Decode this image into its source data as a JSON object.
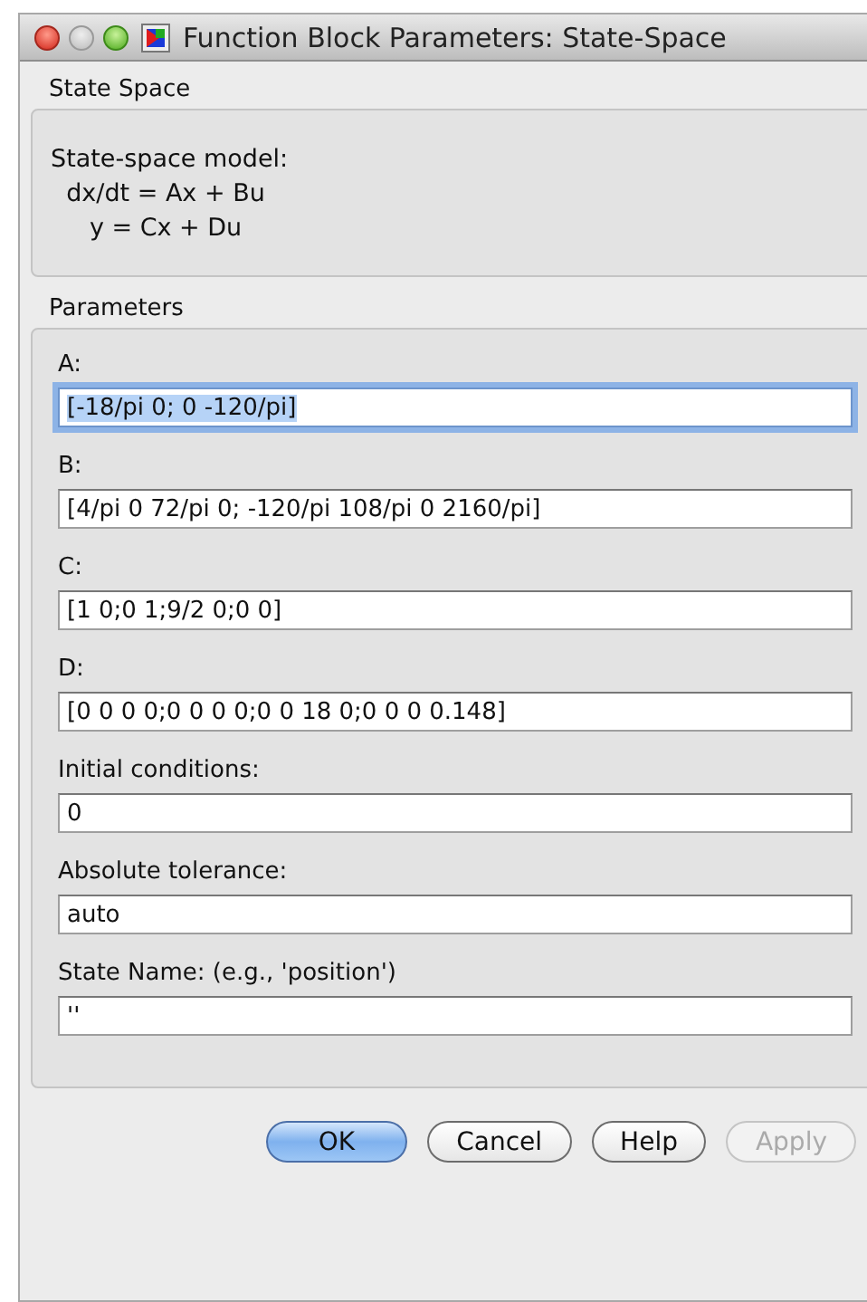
{
  "window": {
    "title": "Function Block Parameters: State-Space"
  },
  "block": {
    "name": "State Space",
    "description": [
      "State-space model:",
      "  dx/dt = Ax + Bu",
      "     y = Cx + Du"
    ]
  },
  "parameters": {
    "title": "Parameters",
    "fields": [
      {
        "label": "A:",
        "value": "[-18/pi 0; 0 -120/pi]",
        "focused": true
      },
      {
        "label": "B:",
        "value": "[4/pi 0 72/pi 0; -120/pi 108/pi 0 2160/pi]",
        "focused": false
      },
      {
        "label": "C:",
        "value": "[1 0;0 1;9/2 0;0 0]",
        "focused": false
      },
      {
        "label": "D:",
        "value": "[0 0 0 0;0 0 0 0;0 0 18 0;0 0 0 0.148]",
        "focused": false
      },
      {
        "label": "Initial conditions:",
        "value": "0",
        "focused": false
      },
      {
        "label": "Absolute tolerance:",
        "value": "auto",
        "focused": false
      },
      {
        "label": "State Name: (e.g., 'position')",
        "value": "''",
        "focused": false
      }
    ]
  },
  "buttons": [
    {
      "label": "OK",
      "kind": "default",
      "disabled": false
    },
    {
      "label": "Cancel",
      "kind": "normal",
      "disabled": false
    },
    {
      "label": "Help",
      "kind": "normal",
      "disabled": false
    },
    {
      "label": "Apply",
      "kind": "normal",
      "disabled": true
    }
  ]
}
